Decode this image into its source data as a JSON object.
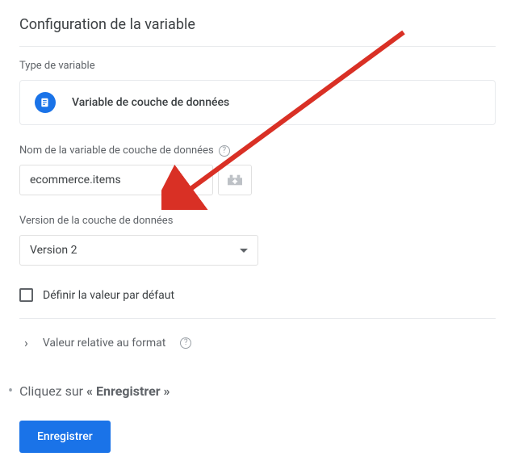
{
  "title": "Configuration de la variable",
  "variable_type": {
    "label": "Type de variable",
    "name": "Variable de couche de données"
  },
  "name_field": {
    "label": "Nom de la variable de couche de données",
    "value": "ecommerce.items"
  },
  "version_field": {
    "label": "Version de la couche de données",
    "selected": "Version 2"
  },
  "default_value": {
    "label": "Définir la valeur par défaut"
  },
  "format_section": {
    "label": "Valeur relative au format"
  },
  "instruction": {
    "prefix": "Cliquez sur ",
    "bold": "« Enregistrer »"
  },
  "save_button": "Enregistrer"
}
